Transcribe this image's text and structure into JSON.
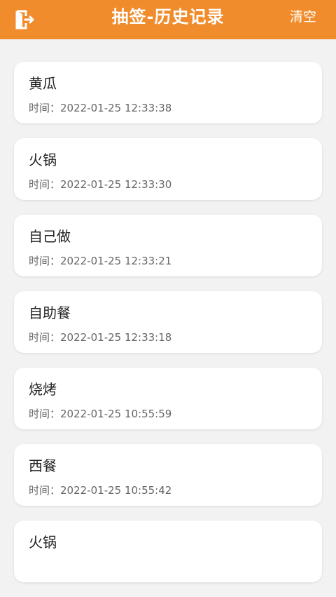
{
  "header": {
    "title": "抽签-历史记录",
    "clear_label": "清空",
    "bg_color": "#f08c2b",
    "back_icon": "exit-door-icon"
  },
  "time_prefix": "时间：",
  "records": [
    {
      "name": "黄瓜",
      "time": "2022-01-25 12:33:38"
    },
    {
      "name": "火锅",
      "time": "2022-01-25 12:33:30"
    },
    {
      "name": "自己做",
      "time": "2022-01-25 12:33:21"
    },
    {
      "name": "自助餐",
      "time": "2022-01-25 12:33:18"
    },
    {
      "name": "烧烤",
      "time": "2022-01-25 10:55:59"
    },
    {
      "name": "西餐",
      "time": "2022-01-25 10:55:42"
    },
    {
      "name": "火锅",
      "time": ""
    }
  ]
}
